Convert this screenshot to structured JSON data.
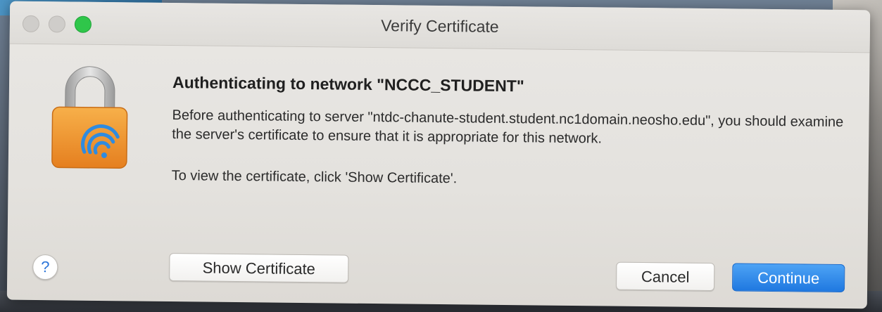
{
  "window": {
    "title": "Verify Certificate"
  },
  "icon": {
    "name": "lock-wifi-icon",
    "lock_color": "#f0932b",
    "shackle_color": "#c8c8c8",
    "wifi_color": "#2f8be0"
  },
  "content": {
    "heading": "Authenticating to network \"NCCC_STUDENT\"",
    "paragraph1": "Before authenticating to server \"ntdc-chanute-student.student.nc1domain.neosho.edu\", you should examine the server's certificate to ensure that it is appropriate for this network.",
    "paragraph2": "To view the certificate, click 'Show Certificate'."
  },
  "buttons": {
    "help": "?",
    "show_certificate": "Show Certificate",
    "cancel": "Cancel",
    "continue": "Continue"
  },
  "colors": {
    "accent": "#1f78e0",
    "zoom_green": "#2fc64a"
  }
}
